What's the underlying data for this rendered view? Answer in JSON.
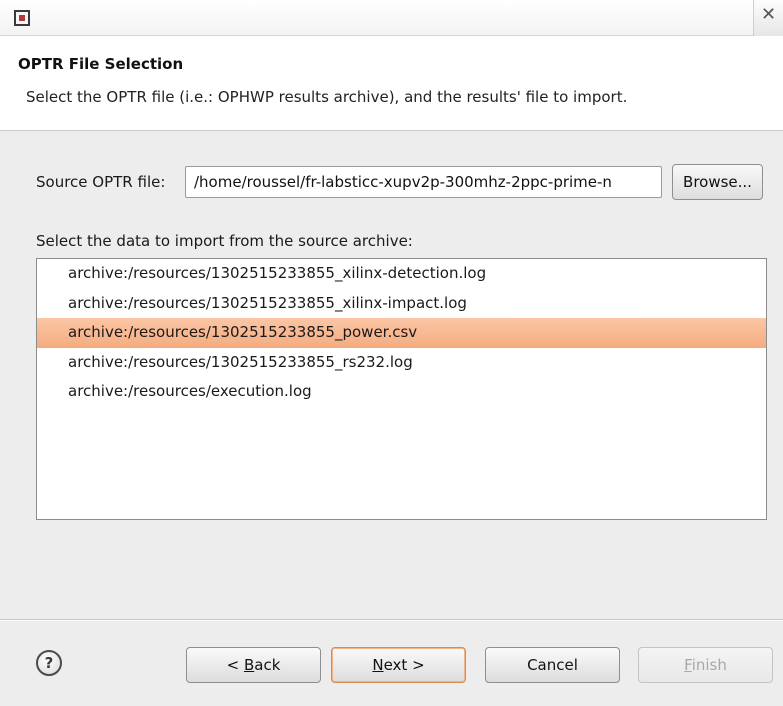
{
  "titlebar": {
    "close_label": "✕"
  },
  "header": {
    "title": "OPTR File Selection",
    "description": "Select the OPTR file (i.e.: OPHWP results archive), and the results' file to import."
  },
  "source": {
    "label": "Source OPTR file:",
    "value": "/home/roussel/fr-labsticc-xupv2p-300mhz-2ppc-prime-n",
    "browse_label": "Browse..."
  },
  "selection": {
    "label": "Select the data to import from the source archive:",
    "items": [
      {
        "label": "archive:/resources/1302515233855_xilinx-detection.log",
        "selected": false
      },
      {
        "label": "archive:/resources/1302515233855_xilinx-impact.log",
        "selected": false
      },
      {
        "label": "archive:/resources/1302515233855_power.csv",
        "selected": true
      },
      {
        "label": "archive:/resources/1302515233855_rs232.log",
        "selected": false
      },
      {
        "label": "archive:/resources/execution.log",
        "selected": false
      }
    ]
  },
  "buttons": {
    "help_label": "?",
    "back_prefix": "< ",
    "back_mnemonic": "B",
    "back_rest": "ack",
    "next_mnemonic": "N",
    "next_rest": "ext >",
    "cancel_label": "Cancel",
    "finish_mnemonic": "F",
    "finish_rest": "inish",
    "finish_enabled": false
  },
  "icons": {
    "app": "app-window-icon",
    "close": "close-icon",
    "help": "help-icon"
  },
  "colors": {
    "selection": "#f5ab7f",
    "default_button_border": "#d98a52",
    "disabled_text": "#a8a8a8"
  }
}
